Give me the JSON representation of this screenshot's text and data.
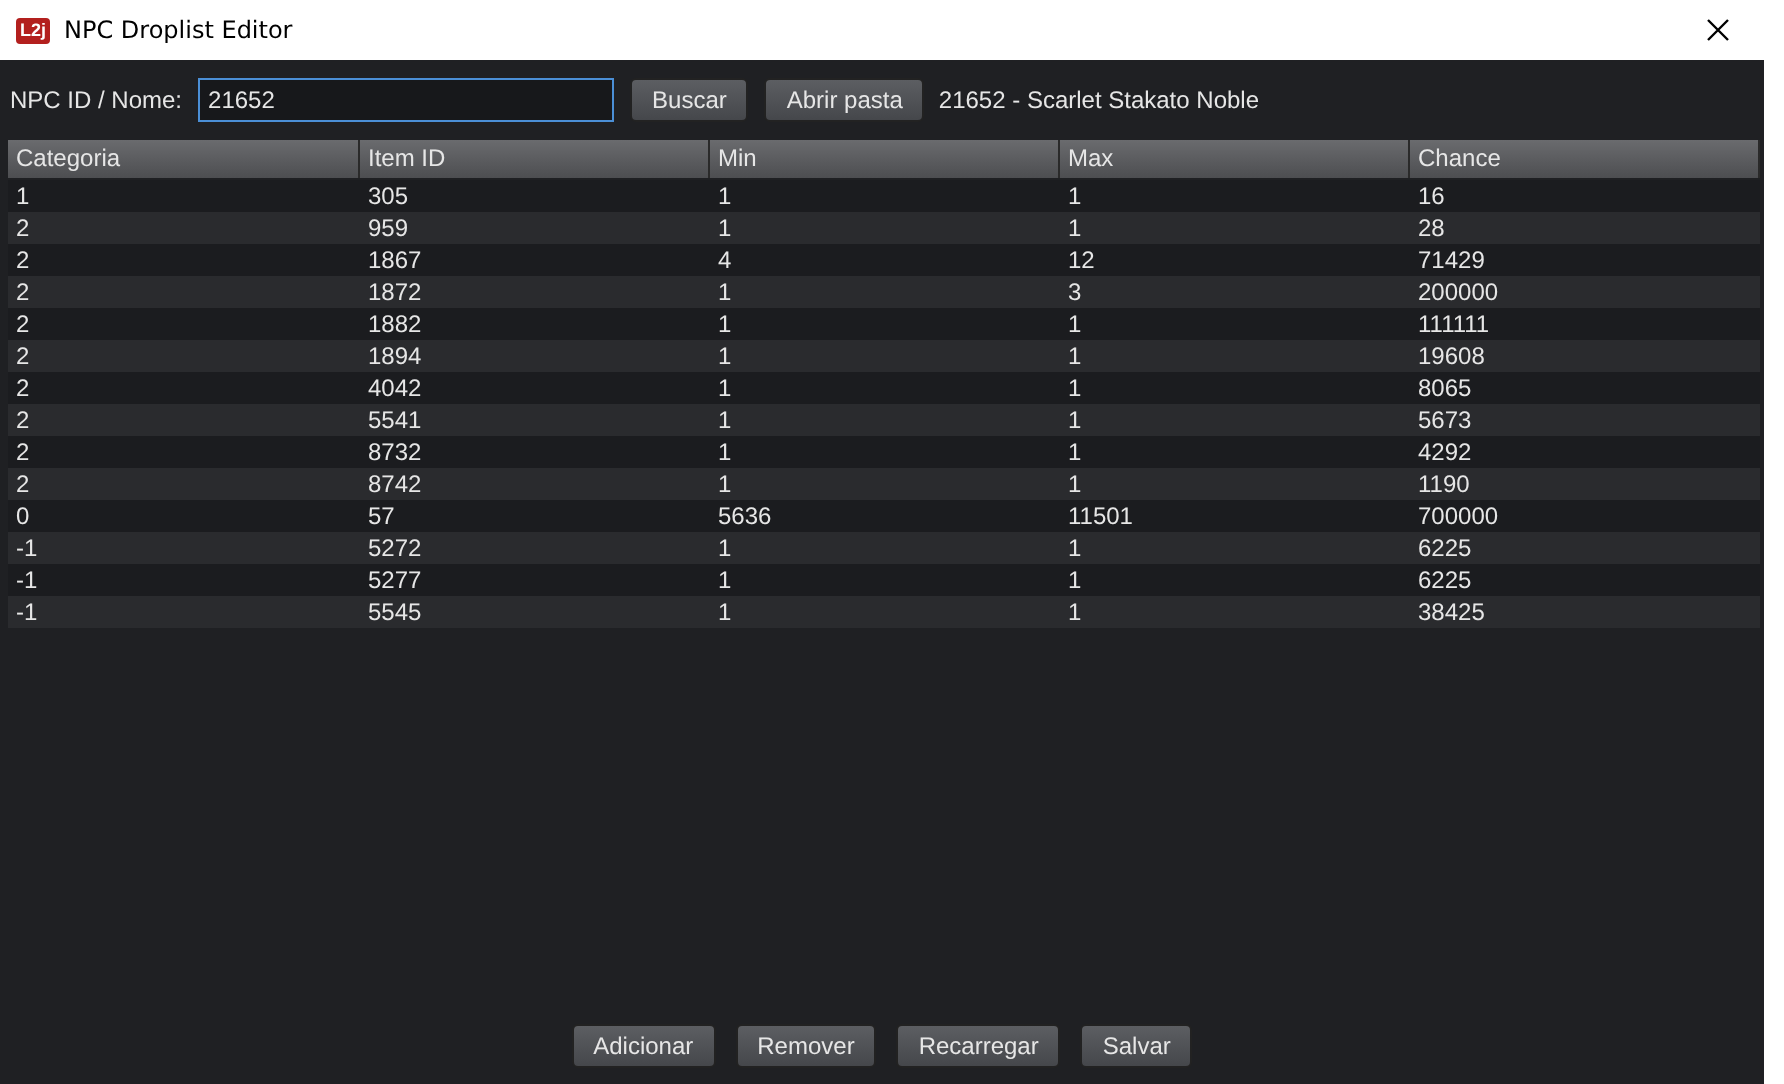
{
  "window": {
    "title": "NPC Droplist Editor",
    "logo": "L2j"
  },
  "search": {
    "label": "NPC ID / Nome:",
    "value": "21652",
    "focused": true
  },
  "toolbar_buttons": [
    "Buscar",
    "Abrir pasta"
  ],
  "npc_name": "21652 - Scarlet Stakato Noble",
  "table": {
    "columns": [
      "Categoria",
      "Item ID",
      "Min",
      "Max",
      "Chance"
    ],
    "rows": [
      [
        "1",
        "305",
        "1",
        "1",
        "16"
      ],
      [
        "2",
        "959",
        "1",
        "1",
        "28"
      ],
      [
        "2",
        "1867",
        "4",
        "12",
        "71429"
      ],
      [
        "2",
        "1872",
        "1",
        "3",
        "200000"
      ],
      [
        "2",
        "1882",
        "1",
        "1",
        "111111"
      ],
      [
        "2",
        "1894",
        "1",
        "1",
        "19608"
      ],
      [
        "2",
        "4042",
        "1",
        "1",
        "8065"
      ],
      [
        "2",
        "5541",
        "1",
        "1",
        "5673"
      ],
      [
        "2",
        "8732",
        "1",
        "1",
        "4292"
      ],
      [
        "2",
        "8742",
        "1",
        "1",
        "1190"
      ],
      [
        "0",
        "57",
        "5636",
        "11501",
        "700000"
      ],
      [
        "-1",
        "5272",
        "1",
        "1",
        "6225"
      ],
      [
        "-1",
        "5277",
        "1",
        "1",
        "6225"
      ],
      [
        "-1",
        "5545",
        "1",
        "1",
        "38425"
      ]
    ]
  },
  "footer_buttons": [
    "Adicionar",
    "Remover",
    "Recarregar",
    "Salvar"
  ]
}
